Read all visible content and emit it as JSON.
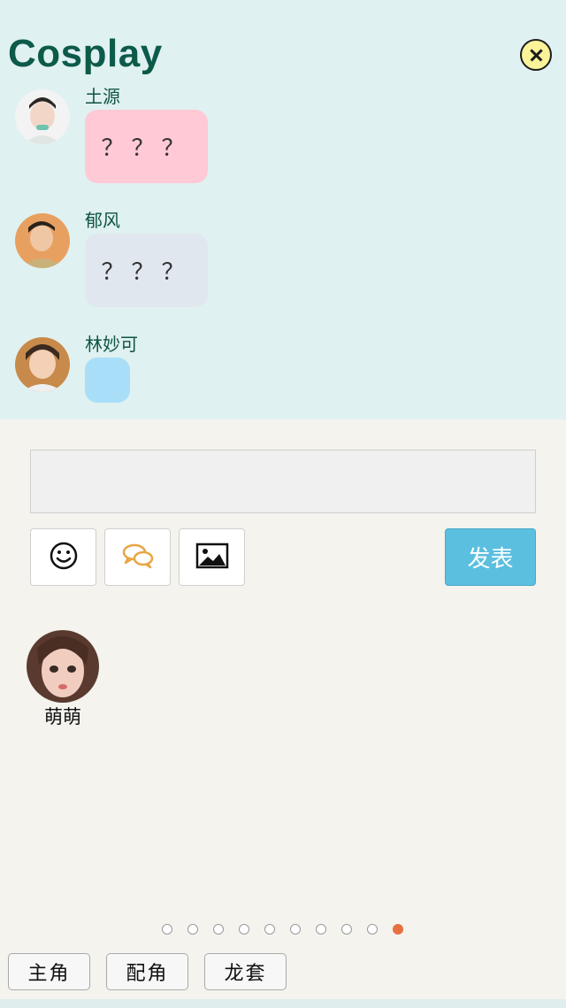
{
  "header": {
    "title": "Cosplay",
    "close_icon": "close-icon"
  },
  "messages": [
    {
      "name": "土源",
      "text": "？？？",
      "bubble_color": "#ffc9d5"
    },
    {
      "name": "郁风",
      "text": "？？？",
      "bubble_color": "#e1e7ef"
    },
    {
      "name": "林妙可",
      "text": "",
      "bubble_color": "#a9def8"
    }
  ],
  "composer": {
    "input_value": "",
    "tools": [
      "smiley-icon",
      "chat-bubbles-icon",
      "image-icon"
    ],
    "send_label": "发表",
    "send_color": "#5bbfe0"
  },
  "current_user": {
    "name": "萌萌"
  },
  "pagination": {
    "total": 10,
    "active": 10,
    "active_color": "#e87040"
  },
  "roles": [
    "主角",
    "配角",
    "龙套"
  ]
}
